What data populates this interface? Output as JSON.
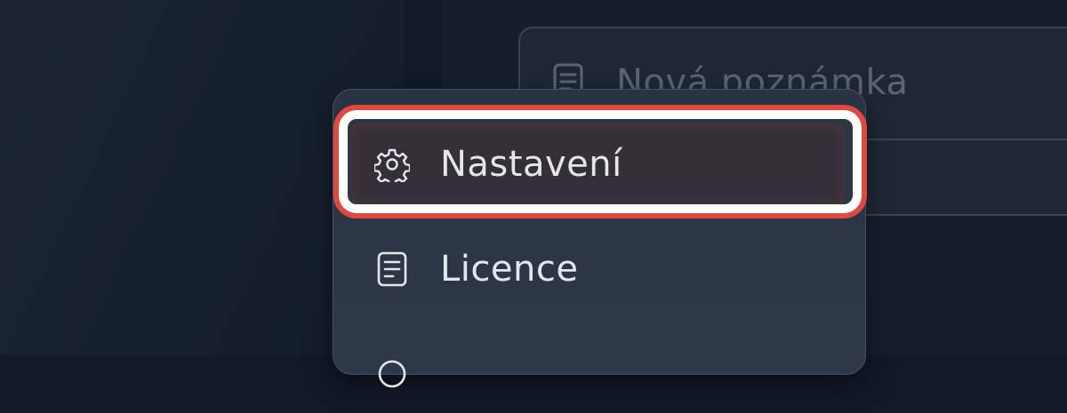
{
  "editor": {
    "new_note_placeholder": "Nová poznámka",
    "note_icon": "document-icon"
  },
  "menu": {
    "items": [
      {
        "label": "Nastavení",
        "icon": "gear-icon",
        "highlighted": true
      },
      {
        "label": "Licence",
        "icon": "document-icon",
        "highlighted": false
      }
    ]
  },
  "colors": {
    "background": "#111827",
    "menu_background": "#2a3341",
    "highlight_border": "#e0493e",
    "text": "#e2e6ed",
    "placeholder_text": "#5b6475"
  }
}
